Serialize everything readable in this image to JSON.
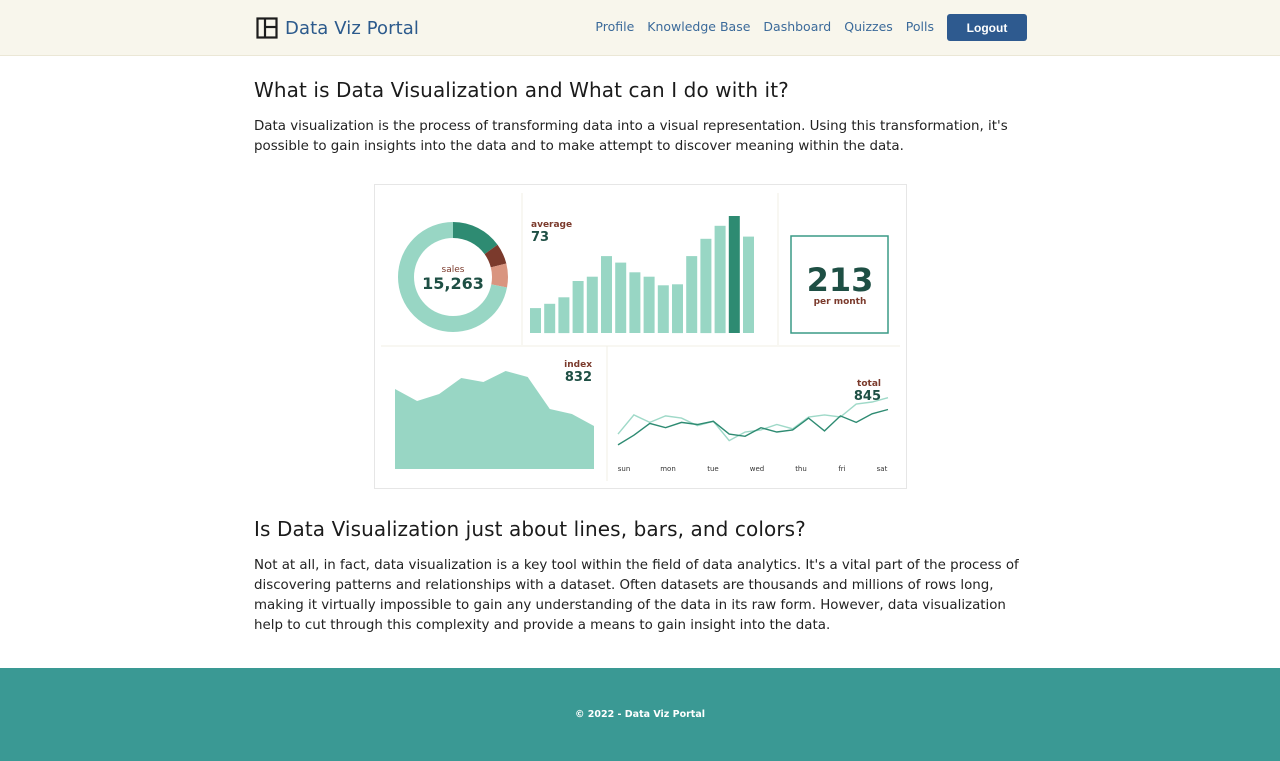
{
  "brand": {
    "title": "Data Viz Portal",
    "icon": "layout-grid-icon"
  },
  "nav": {
    "links": [
      "Profile",
      "Knowledge Base",
      "Dashboard",
      "Quizzes",
      "Polls"
    ],
    "logout_label": "Logout"
  },
  "colors": {
    "nav_bg": "#f8f6ec",
    "brand_blue": "#2c5a8c",
    "button_blue": "#2e5a8f",
    "footer_teal": "#3a9994",
    "chart_mint": "#98d6c4",
    "chart_dark_green": "#2e8b72",
    "chart_salmon": "#d99580",
    "chart_brown": "#7b3a2c"
  },
  "section1": {
    "heading": "What is Data Visualization and What can I do with it?",
    "body": "Data visualization is the process of transforming data into a visual representation. Using this transformation, it's possible to gain insights into the data and to make attempt to discover meaning within the data."
  },
  "dashboard_image": {
    "donut": {
      "label": "sales",
      "value": "15,263"
    },
    "bars": {
      "label": "average",
      "value": "73"
    },
    "kpi": {
      "value": "213",
      "caption": "per month"
    },
    "area": {
      "label": "index",
      "value": "832"
    },
    "lines": {
      "label": "total",
      "value": "845",
      "days": [
        "sun",
        "mon",
        "tue",
        "wed",
        "thu",
        "fri",
        "sat"
      ]
    }
  },
  "chart_data": [
    {
      "type": "pie",
      "title": "sales",
      "values": [
        15,
        6,
        7,
        72
      ],
      "colors": [
        "#2e8b72",
        "#7b3a2c",
        "#d99580",
        "#98d6c4"
      ]
    },
    {
      "type": "bar",
      "title": "average",
      "values": [
        23,
        27,
        33,
        48,
        52,
        71,
        65,
        56,
        52,
        44,
        45,
        71,
        87,
        99,
        108,
        89
      ],
      "highlight_index": 14,
      "ylim": [
        0,
        120
      ]
    },
    {
      "type": "area",
      "title": "index",
      "values": [
        80,
        68,
        75,
        91,
        87,
        98,
        92,
        60,
        55,
        43
      ],
      "ylim": [
        0,
        110
      ]
    },
    {
      "type": "line",
      "title": "total",
      "x": [
        "sun",
        "mon",
        "tue",
        "wed",
        "thu",
        "fri",
        "sat"
      ],
      "series": [
        {
          "values": [
            26,
            44,
            37,
            43,
            41,
            34,
            38,
            20,
            28,
            30,
            35,
            31,
            42,
            44,
            42,
            54,
            56,
            60
          ]
        },
        {
          "values": [
            16,
            25,
            36,
            32,
            37,
            35,
            38,
            26,
            24,
            32,
            28,
            30,
            41,
            29,
            43,
            37,
            45,
            49
          ]
        }
      ],
      "ylim": [
        0,
        70
      ]
    }
  ],
  "section2": {
    "heading": "Is Data Visualization just about lines, bars, and colors?",
    "body": "Not at all, in fact, data visualization is a key tool within the field of data analytics. It's a vital part of the process of discovering patterns and relationships with a dataset. Often datasets are thousands and millions of rows long, making it virtually impossible to gain any understanding of the data in its raw form. However, data visualization help to cut through this complexity and provide a means to gain insight into the data."
  },
  "footer": {
    "text": "© 2022 - Data Viz Portal"
  }
}
